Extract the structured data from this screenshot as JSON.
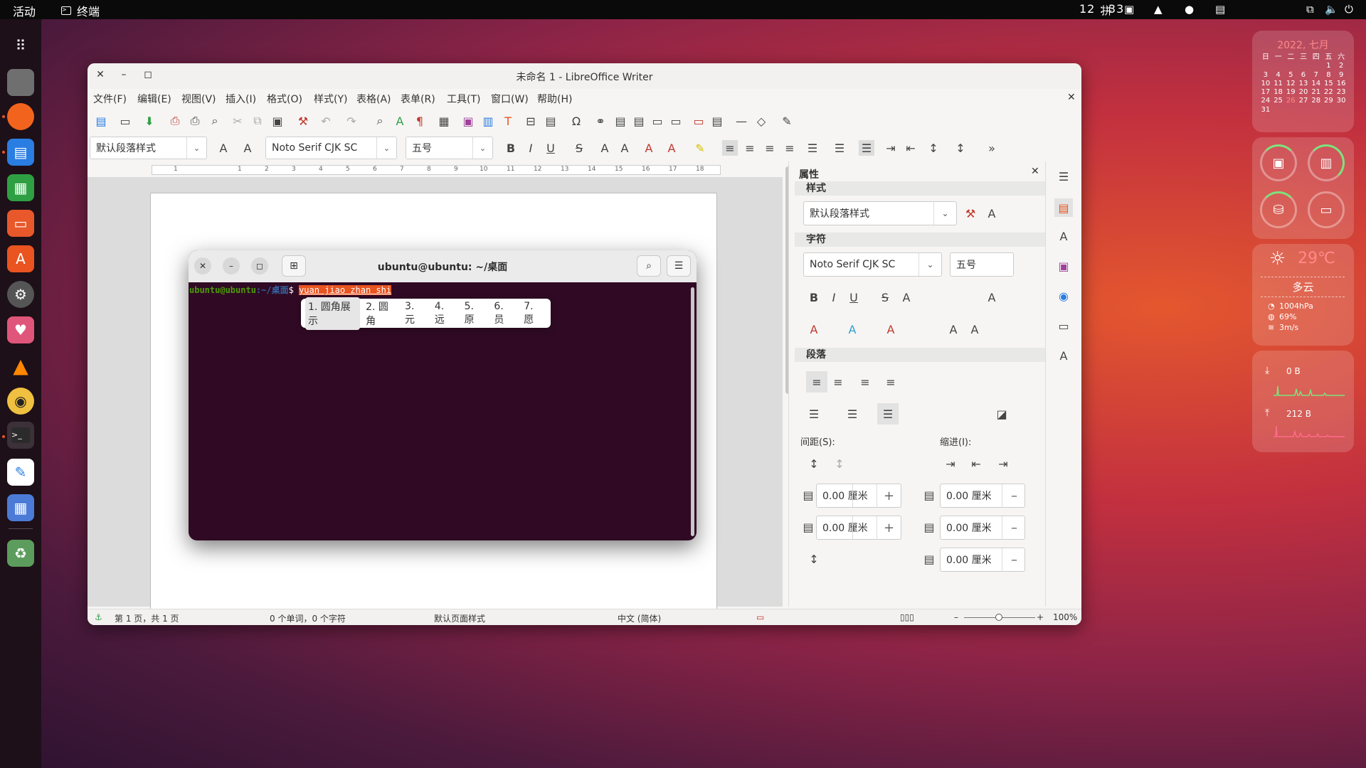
{
  "topbar": {
    "activities": "活动",
    "app_name": "终端",
    "input_method": "拼",
    "clock": "12 : 33"
  },
  "dock": {
    "items": [
      {
        "name": "show-apps-icon"
      },
      {
        "name": "files-icon"
      },
      {
        "name": "firefox-icon"
      },
      {
        "name": "writer-icon"
      },
      {
        "name": "calc-icon"
      },
      {
        "name": "impress-icon"
      },
      {
        "name": "software-icon"
      },
      {
        "name": "settings-icon"
      },
      {
        "name": "app-icon"
      },
      {
        "name": "vlc-icon"
      },
      {
        "name": "rhythmbox-icon"
      },
      {
        "name": "terminal-icon"
      },
      {
        "name": "text-editor-icon"
      },
      {
        "name": "screenshot-icon"
      },
      {
        "name": "trash-icon"
      }
    ]
  },
  "writer": {
    "title": "未命名 1 - LibreOffice Writer",
    "menu": [
      "文件(F)",
      "编辑(E)",
      "视图(V)",
      "插入(I)",
      "格式(O)",
      "样式(Y)",
      "表格(A)",
      "表单(R)",
      "工具(T)",
      "窗口(W)",
      "帮助(H)"
    ],
    "toolbar": {
      "paragraph_style": "默认段落样式",
      "font_name": "Noto Serif CJK SC",
      "font_size": "五号"
    },
    "ruler_ticks": [
      "1",
      "1",
      "2",
      "3",
      "4",
      "5",
      "6",
      "7",
      "8",
      "9",
      "10",
      "11",
      "12",
      "13",
      "14",
      "15",
      "16",
      "17",
      "18"
    ],
    "sidebar": {
      "title": "属性",
      "style_section": "样式",
      "style_value": "默认段落样式",
      "char_section": "字符",
      "char_font": "Noto Serif CJK SC",
      "char_size": "五号",
      "para_section": "段落",
      "spacing_label": "间距(S):",
      "indent_label": "缩进(I):",
      "spin_values": [
        "0.00 厘米",
        "0.00 厘米",
        "0.00 厘米",
        "0.00 厘米",
        "0.00 厘米"
      ]
    },
    "status": {
      "page": "第 1 页，共 1 页",
      "words": "0 个单词，0 个字符",
      "page_style": "默认页面样式",
      "language": "中文 (简体)",
      "zoom": "100%"
    }
  },
  "terminal": {
    "title": "ubuntu@ubuntu: ~/桌面",
    "prompt_user": "ubuntu@ubuntu",
    "prompt_path": ":~/桌面",
    "prompt_symbol": "$ ",
    "preedit": "yuan jiao zhan shi",
    "candidates": [
      "1. 圆角展示",
      "2. 圆角",
      "3. 元",
      "4. 远",
      "5. 原",
      "6. 员",
      "7. 愿"
    ]
  },
  "widgets": {
    "calendar": {
      "header": "2022, 七月",
      "weekdays": [
        "日",
        "一",
        "二",
        "三",
        "四",
        "五",
        "六"
      ],
      "days": [
        "",
        "",
        "",
        "",
        "",
        "1",
        "2",
        "3",
        "4",
        "5",
        "6",
        "7",
        "8",
        "9",
        "10",
        "11",
        "12",
        "13",
        "14",
        "15",
        "16",
        "17",
        "18",
        "19",
        "20",
        "21",
        "22",
        "23",
        "24",
        "25",
        "26",
        "27",
        "28",
        "29",
        "30",
        "31"
      ],
      "today": "26"
    },
    "weather": {
      "temp": "29℃",
      "desc": "多云",
      "pressure": "1004hPa",
      "humidity": "69%",
      "wind": "3m/s"
    },
    "network": {
      "download": "0 B",
      "upload": "212 B"
    }
  },
  "colors": {
    "accent": "#e95420",
    "terminal_bg": "#300a24"
  }
}
